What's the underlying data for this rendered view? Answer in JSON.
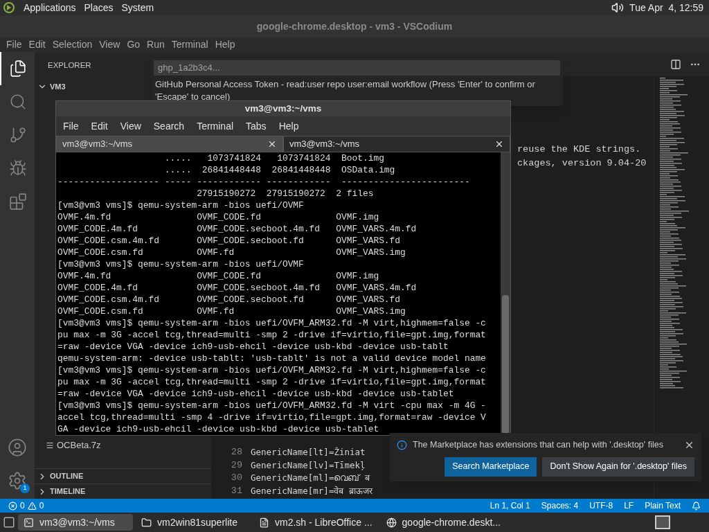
{
  "top_panel": {
    "menus": [
      "Applications",
      "Places",
      "System"
    ],
    "clock": "Tue Apr  4, 12:59"
  },
  "window": {
    "title": "google-chrome.desktop - vm3 - VSCodium",
    "menus": [
      "File",
      "Edit",
      "Selection",
      "View",
      "Go",
      "Run",
      "Terminal",
      "Help"
    ]
  },
  "activity_bar": [
    {
      "kind": "files",
      "selected": true
    },
    {
      "kind": "search",
      "selected": false
    },
    {
      "kind": "source-control",
      "selected": false
    },
    {
      "kind": "debug",
      "selected": false
    },
    {
      "kind": "extensions",
      "selected": false
    }
  ],
  "activity_bottom": {
    "settings_badge": "1"
  },
  "sidebar": {
    "title": "EXPLORER",
    "folder": "VM3",
    "files": [
      "OCBeta.7z"
    ],
    "sections": [
      "OUTLINE",
      "TIMELINE"
    ]
  },
  "editor": {
    "fragments": [
      "reuse the KDE strings.",
      "ckages, version 9.04-20"
    ],
    "lines": [
      {
        "number": "28",
        "text": "GenericName[lt]=Žiniat"
      },
      {
        "number": "29",
        "text": "GenericName[lv]=Tīmekļ"
      },
      {
        "number": "30",
        "text": "GenericName[ml]=വെബ് ब"
      },
      {
        "number": "31",
        "text": "GenericName[mr]=वेब ब्राऊजर"
      }
    ]
  },
  "quick_input": {
    "value": "ghp_1a2b3c4...",
    "message": "GitHub Personal Access Token - read:user repo user:email workflow (Press 'Enter' to confirm or 'Escape' to cancel)"
  },
  "terminal": {
    "title": "vm3@vm3:~/vms",
    "menus": [
      "File",
      "Edit",
      "View",
      "Search",
      "Terminal",
      "Tabs",
      "Help"
    ],
    "tabs": [
      {
        "label": "vm3@vm3:~/vms",
        "selected": false
      },
      {
        "label": "vm3@vm3:~/vms",
        "selected": true
      }
    ],
    "lines": [
      "                    .....   1073741824   1073741824  Boot.img",
      "                    .....  26841448448  26841448448  OSData.img",
      "------------------- ----- ------------ ------------  ------------------------",
      "                          27915190272  27915190272  2 files",
      "[vm3@vm3 vms]$ qemu-system-arm -bios uefi/OVMF",
      "OVMF.4m.fd                OVMF_CODE.fd              OVMF.img",
      "OVMF_CODE.4m.fd           OVMF_CODE.secboot.4m.fd   OVMF_VARS.4m.fd",
      "OVMF_CODE.csm.4m.fd       OVMF_CODE.secboot.fd      OVMF_VARS.fd",
      "OVMF_CODE.csm.fd          OVMF.fd                   OVMF_VARS.img",
      "[vm3@vm3 vms]$ qemu-system-arm -bios uefi/OVMF",
      "OVMF.4m.fd                OVMF_CODE.fd              OVMF.img",
      "OVMF_CODE.4m.fd           OVMF_CODE.secboot.4m.fd   OVMF_VARS.4m.fd",
      "OVMF_CODE.csm.4m.fd       OVMF_CODE.secboot.fd      OVMF_VARS.fd",
      "OVMF_CODE.csm.fd          OVMF.fd                   OVMF_VARS.img",
      "[vm3@vm3 vms]$ qemu-system-arm -bios uefi/OVFM_ARM32.fd -M virt,highmem=false -c",
      "pu max -m 3G -accel tcg,thread=multi -smp 2 -drive if=virtio,file=gpt.img,format",
      "=raw -device VGA -device ich9-usb-ehcil -device usb-kbd -device usb-tablt",
      "qemu-system-arm: -device usb-tablt: 'usb-tablt' is not a valid device model name",
      "[vm3@vm3 vms]$ qemu-system-arm -bios uefi/OVFM_ARM32.fd -M virt,highmem=false -c",
      "pu max -m 3G -accel tcg,thread=multi -smp 2 -drive if=virtio,file=gpt.img,format",
      "=raw -device VGA -device ich9-usb-ehcil -device usb-kbd -device usb-tablet",
      "[vm3@vm3 vms]$ qemu-system-arm -bios uefi/OVFM_ARM32.fd -M virt -cpu max -m 4G -",
      "accel tcg,thread=multi -smp 4 -drive if=virtio,file=gpt.img,format=raw -device V",
      "GA -device ich9-usb-ehcil -device usb-kbd -device usb-tablet"
    ]
  },
  "notification": {
    "message": "The Marketplace has extensions that can help with '.desktop' files",
    "buttons": [
      {
        "label": "Search Marketplace",
        "kind": "primary"
      },
      {
        "label": "Don't Show Again for '.desktop' files",
        "kind": "secondary"
      }
    ]
  },
  "status_bar": {
    "errors": "0",
    "warnings": "0",
    "items": [
      "Ln 1, Col 1",
      "Spaces: 4",
      "UTF-8",
      "LF",
      "Plain Text"
    ]
  },
  "taskbar": [
    {
      "label": "vm3@vm3:~/vms",
      "kind": "terminal",
      "selected": true
    },
    {
      "label": "vm2win81superlite",
      "kind": "folder",
      "selected": false
    },
    {
      "label": "vm2.sh - LibreOffice ...",
      "kind": "document",
      "selected": false
    },
    {
      "label": "google-chrome.deskt...",
      "kind": "browser",
      "selected": false
    }
  ]
}
